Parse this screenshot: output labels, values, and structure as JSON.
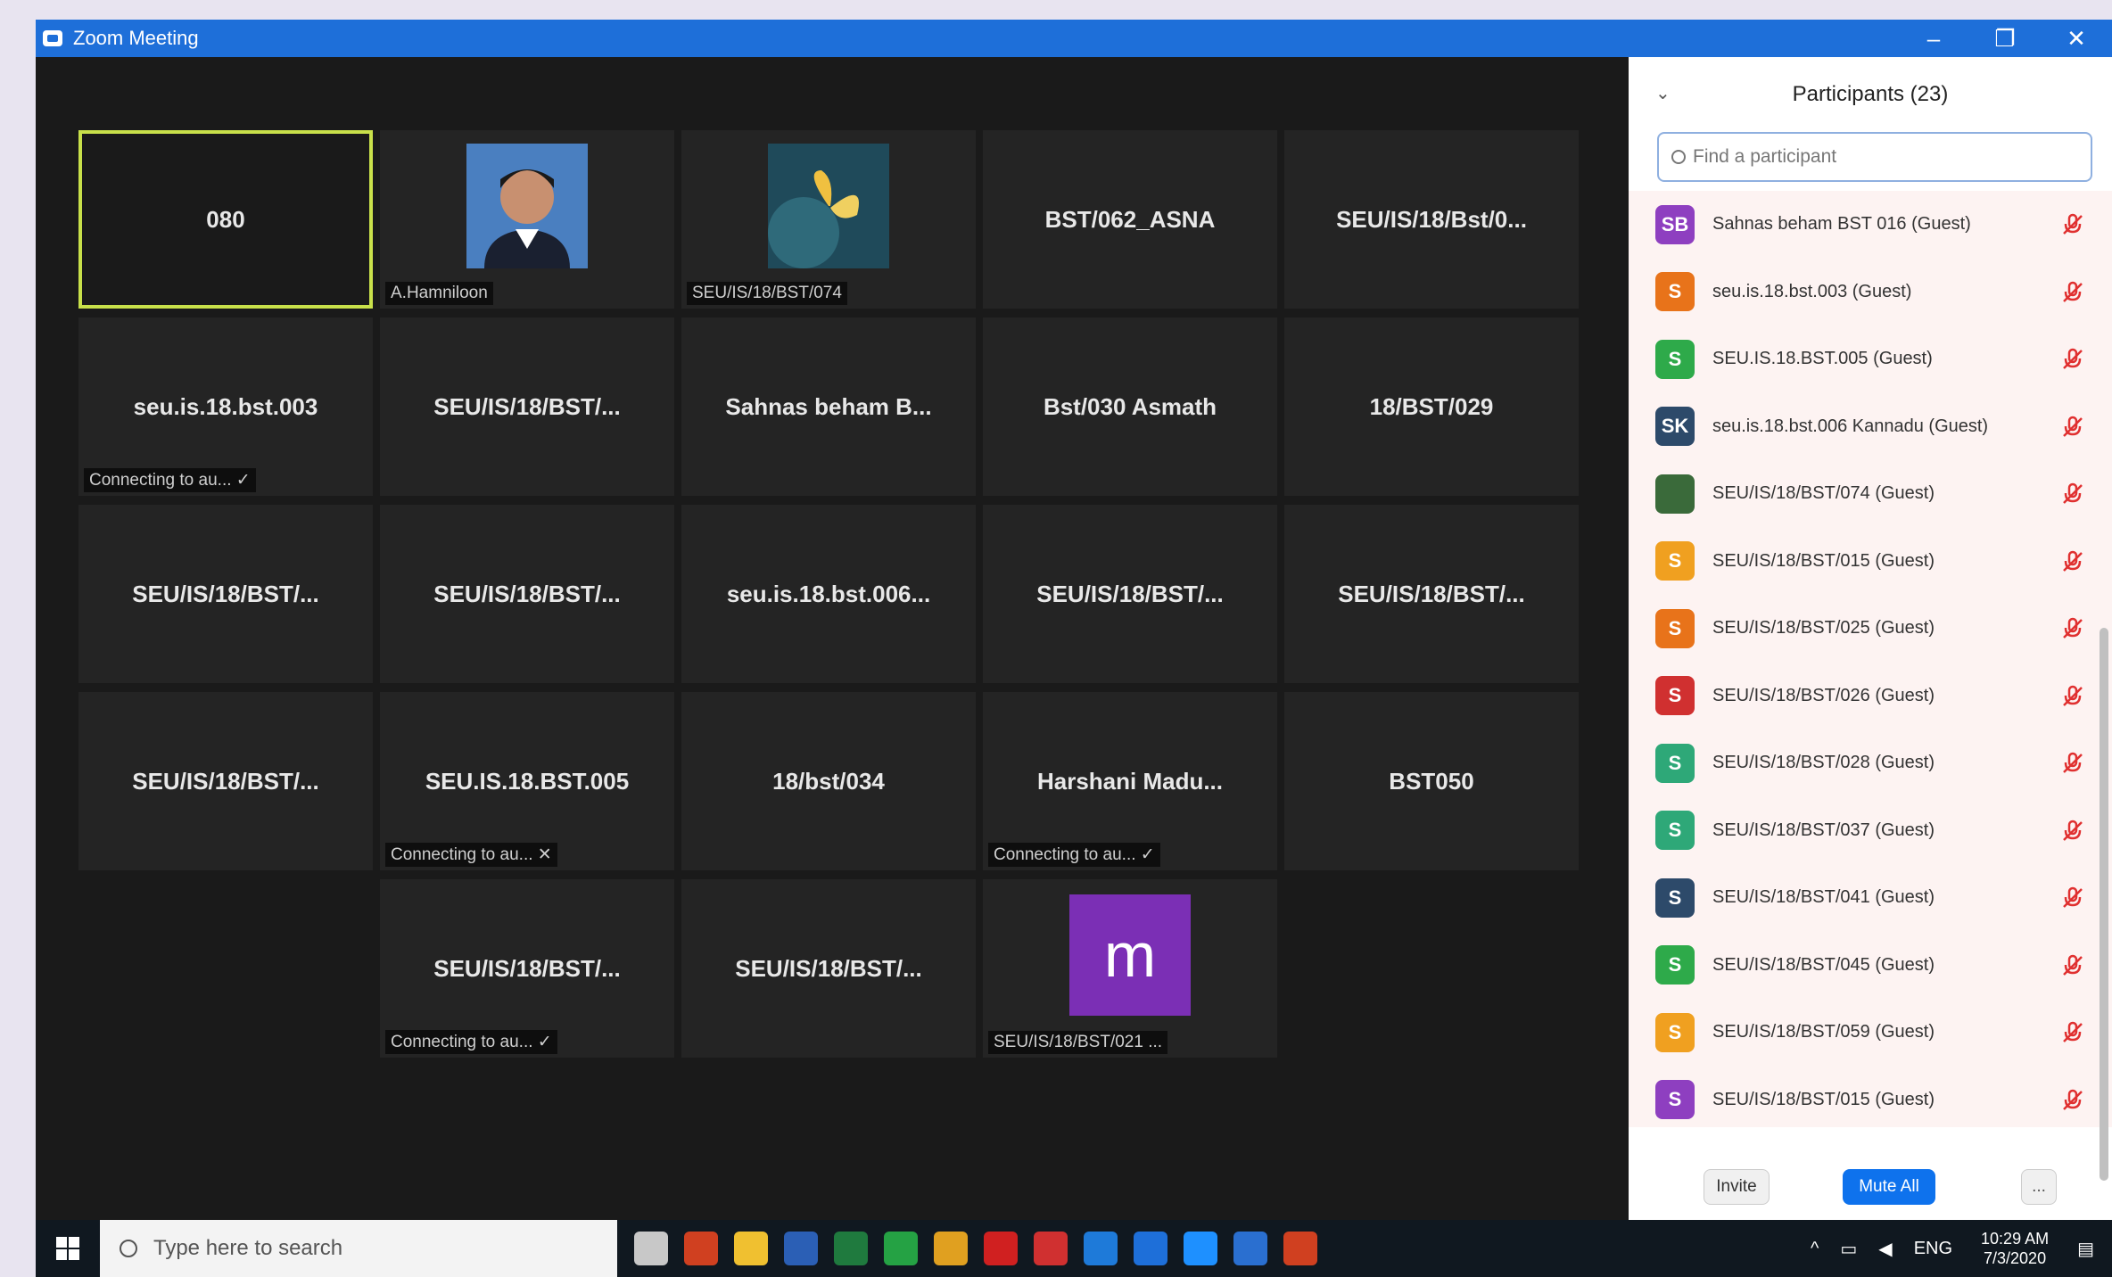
{
  "window": {
    "title": "Zoom Meeting",
    "controls": [
      "–",
      "❐",
      "✕"
    ]
  },
  "tiles": [
    {
      "name": "080",
      "active": true
    },
    {
      "name": "",
      "caption": "A.Hamniloon",
      "photo": "person"
    },
    {
      "name": "",
      "caption": "SEU/IS/18/BST/074",
      "photo": "butterfly"
    },
    {
      "name": "BST/062_ASNA"
    },
    {
      "name": "SEU/IS/18/Bst/0..."
    },
    {
      "name": "seu.is.18.bst.003",
      "caption": "Connecting to au... ✓"
    },
    {
      "name": "SEU/IS/18/BST/..."
    },
    {
      "name": "Sahnas beham B..."
    },
    {
      "name": "Bst/030 Asmath"
    },
    {
      "name": "18/BST/029"
    },
    {
      "name": "SEU/IS/18/BST/..."
    },
    {
      "name": "SEU/IS/18/BST/..."
    },
    {
      "name": "seu.is.18.bst.006..."
    },
    {
      "name": "SEU/IS/18/BST/..."
    },
    {
      "name": "SEU/IS/18/BST/..."
    },
    {
      "name": "SEU/IS/18/BST/..."
    },
    {
      "name": "SEU.IS.18.BST.005",
      "caption": "Connecting to au... ✕"
    },
    {
      "name": "18/bst/034"
    },
    {
      "name": "Harshani Madu...",
      "caption": "Connecting to au... ✓"
    },
    {
      "name": "BST050"
    },
    {
      "name": "SEU/IS/18/BST/...",
      "caption": "Connecting to au... ✓"
    },
    {
      "name": "SEU/IS/18/BST/..."
    },
    {
      "name": "",
      "caption": "SEU/IS/18/BST/021 ...",
      "letter": "m"
    }
  ],
  "panel": {
    "title": "Participants (23)",
    "search_placeholder": "Find a participant",
    "participants": [
      {
        "initials": "SB",
        "color": "#8e3fc0",
        "name": "Sahnas beham BST 016 (Guest)"
      },
      {
        "initials": "S",
        "color": "#e8731a",
        "name": "seu.is.18.bst.003 (Guest)"
      },
      {
        "initials": "S",
        "color": "#2eaa4a",
        "name": "SEU.IS.18.BST.005 (Guest)"
      },
      {
        "initials": "SK",
        "color": "#2d4a6a",
        "name": "seu.is.18.bst.006 Kannadu (Guest)"
      },
      {
        "initials": "",
        "color": "#3a6a3a",
        "name": "SEU/IS/18/BST/074 (Guest)"
      },
      {
        "initials": "S",
        "color": "#f0a020",
        "name": "SEU/IS/18/BST/015 (Guest)"
      },
      {
        "initials": "S",
        "color": "#e8731a",
        "name": "SEU/IS/18/BST/025 (Guest)"
      },
      {
        "initials": "S",
        "color": "#d03030",
        "name": "SEU/IS/18/BST/026 (Guest)"
      },
      {
        "initials": "S",
        "color": "#2ea878",
        "name": "SEU/IS/18/BST/028 (Guest)"
      },
      {
        "initials": "S",
        "color": "#2ea878",
        "name": "SEU/IS/18/BST/037 (Guest)"
      },
      {
        "initials": "S",
        "color": "#2d4a6a",
        "name": "SEU/IS/18/BST/041 (Guest)"
      },
      {
        "initials": "S",
        "color": "#2eaa4a",
        "name": "SEU/IS/18/BST/045 (Guest)"
      },
      {
        "initials": "S",
        "color": "#f0a020",
        "name": "SEU/IS/18/BST/059 (Guest)"
      },
      {
        "initials": "S",
        "color": "#8e3fc0",
        "name": "SEU/IS/18/BST/015 (Guest)"
      }
    ],
    "footer": {
      "invite": "Invite",
      "mute_all": "Mute All",
      "more": "..."
    }
  },
  "taskbar": {
    "search_placeholder": "Type here to search",
    "icon_colors": [
      "#c8c8c8",
      "#d04020",
      "#f0c030",
      "#2b5fb5",
      "#1f7a3e",
      "#25a244",
      "#e0a020",
      "#d02020",
      "#d03030",
      "#1e7ad9",
      "#1e6fd9",
      "#1e90ff",
      "#2a6fd0",
      "#d04020"
    ],
    "tray": {
      "lang": "ENG",
      "time": "10:29 AM",
      "date": "7/3/2020"
    }
  }
}
